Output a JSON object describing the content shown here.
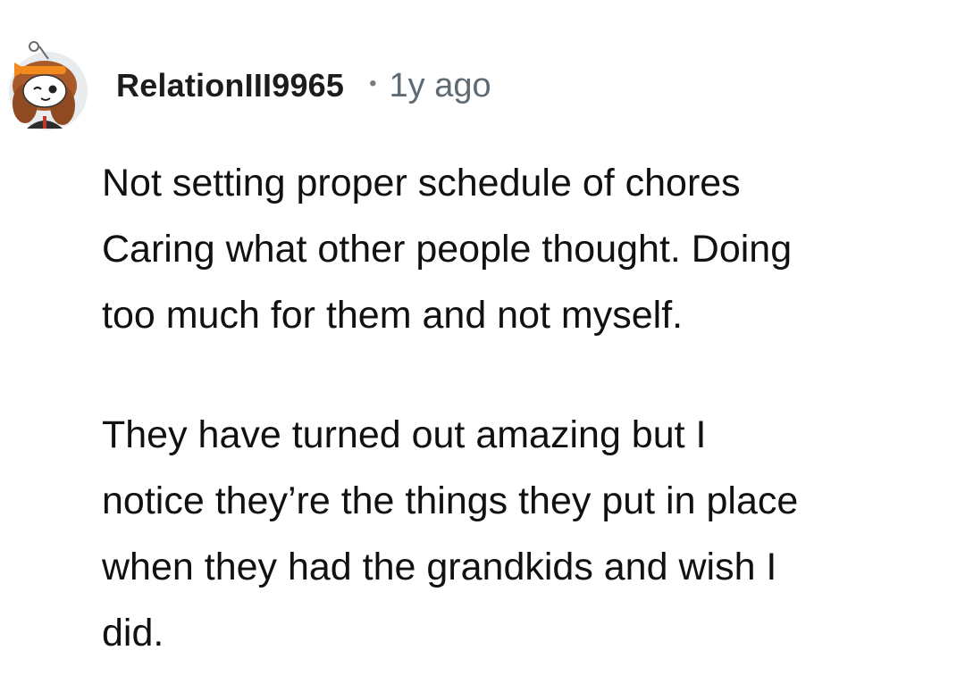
{
  "comment": {
    "author": "RelationIII9965",
    "separator": "•",
    "age": "1y ago",
    "avatar_icon": "snoo-avatar-icon",
    "paragraphs": [
      {
        "lines": [
          "Not setting proper schedule of chores",
          "Caring what other people thought. Doing",
          "too much for them and not myself."
        ]
      },
      {
        "lines": [
          "They have turned out amazing but I",
          "notice they’re the things they put in place",
          "when they had the grandkids and wish I",
          "did."
        ]
      }
    ]
  },
  "colors": {
    "background": "#ffffff",
    "author": "#1c1c1c",
    "meta": "#5f6a72",
    "text": "#111111"
  }
}
